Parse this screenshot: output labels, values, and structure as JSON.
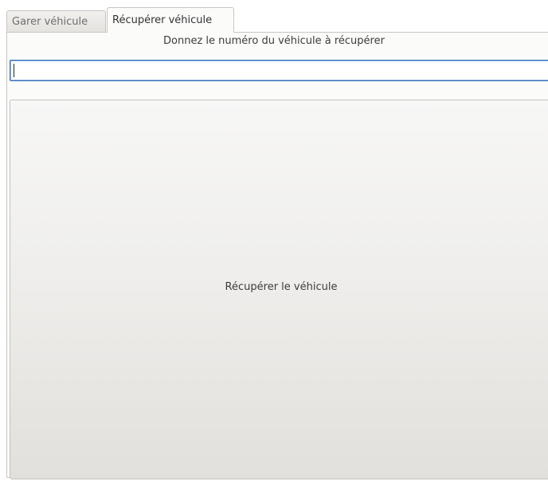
{
  "tabs": [
    {
      "label": "Garer véhicule",
      "active": false
    },
    {
      "label": "Récupérer véhicule",
      "active": true
    }
  ],
  "form": {
    "prompt": "Donnez le numéro du véhicule à récupérer",
    "vehicle_number_value": "",
    "submit_label": "Récupérer le véhicule"
  },
  "colors": {
    "focus_border": "#3d6fb8",
    "pane_background": "#fbfbfa"
  }
}
